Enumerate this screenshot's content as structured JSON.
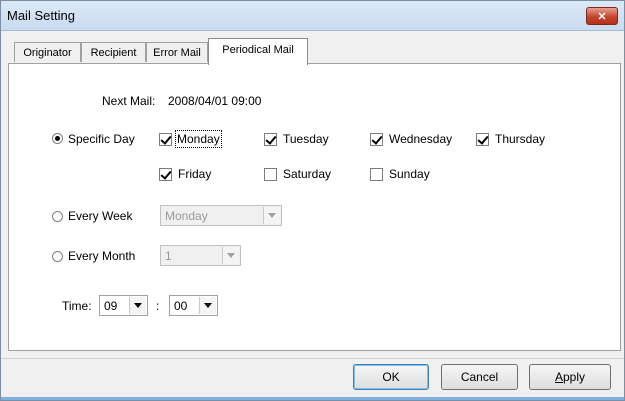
{
  "window": {
    "title": "Mail Setting"
  },
  "tabs": [
    {
      "label": "Originator",
      "active": false
    },
    {
      "label": "Recipient",
      "active": false
    },
    {
      "label": "Error Mail",
      "active": false
    },
    {
      "label": "Periodical Mail",
      "active": true
    }
  ],
  "next_mail": {
    "label": "Next Mail:",
    "value": "2008/04/01  09:00"
  },
  "schedule": {
    "specific_day": {
      "label": "Specific Day",
      "selected": true,
      "days": [
        {
          "label": "Monday",
          "checked": true
        },
        {
          "label": "Tuesday",
          "checked": true
        },
        {
          "label": "Wednesday",
          "checked": true
        },
        {
          "label": "Thursday",
          "checked": true
        },
        {
          "label": "Friday",
          "checked": true
        },
        {
          "label": "Saturday",
          "checked": false
        },
        {
          "label": "Sunday",
          "checked": false
        }
      ]
    },
    "every_week": {
      "label": "Every Week",
      "selected": false,
      "value": "Monday"
    },
    "every_month": {
      "label": "Every Month",
      "selected": false,
      "value": "1"
    }
  },
  "time": {
    "label": "Time:",
    "hour": "09",
    "separator": ":",
    "minute": "00"
  },
  "buttons": {
    "ok": "OK",
    "cancel": "Cancel",
    "apply_first": "A",
    "apply_rest": "pply"
  }
}
